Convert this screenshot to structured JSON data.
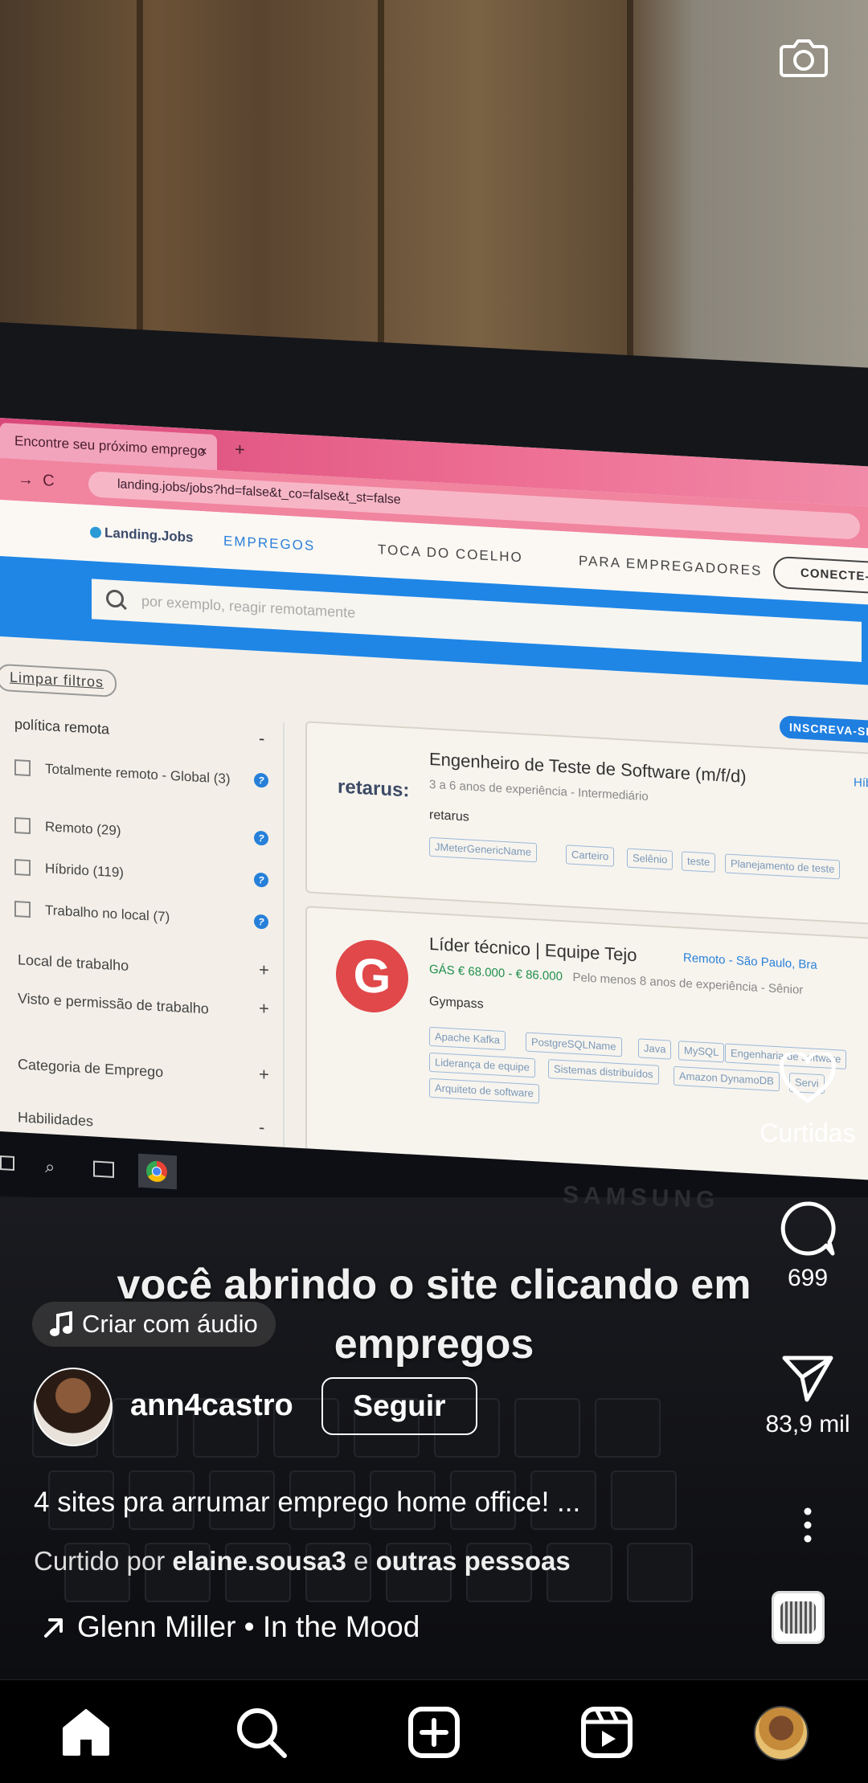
{
  "video": {
    "browser": {
      "tab_title": "Encontre seu próximo emprego",
      "tab_close": "×",
      "new_tab": "+",
      "url": "landing.jobs/jobs?hd=false&t_co=false&t_st=false",
      "nav_back": "→",
      "nav_reload": "C"
    },
    "site": {
      "logo": "Landing.Jobs",
      "nav": [
        "EMPREGOS",
        "TOCA DO COELHO",
        "PARA EMPREGADORES"
      ],
      "cta": "CONECTE-S",
      "search_placeholder": "por exemplo, reagir remotamente",
      "clear_filters": "Limpar filtros",
      "subscribe": "INSCREVA-SE",
      "filter_title": "política remota",
      "filter_minus": "-",
      "filters": [
        {
          "label": "Totalmente remoto - Global (3)"
        },
        {
          "label": "Remoto (29)"
        },
        {
          "label": "Híbrido (119)"
        },
        {
          "label": "Trabalho no local (7)"
        }
      ],
      "help": "?",
      "sections": [
        {
          "label": "Local de trabalho",
          "sign": "+"
        },
        {
          "label": "Visto e permissão de trabalho",
          "sign": "+"
        },
        {
          "label": "Categoria de Emprego",
          "sign": "+"
        },
        {
          "label": "Habilidades",
          "sign": "-"
        }
      ],
      "jobs": [
        {
          "logo": "retarus:",
          "title": "Engenheiro de Teste de Software (m/f/d)",
          "location": "Híbrid",
          "meta": "3 a 6 anos de experiência - Intermediário",
          "company": "retarus",
          "tags": [
            "JMeterGenericName",
            "Carteiro",
            "Selênio",
            "teste",
            "Planejamento de teste"
          ]
        },
        {
          "logo": "G",
          "title": "Líder técnico | Equipe Tejo",
          "location": "Remoto - São Paulo, Bra",
          "salary": "GÁS € 68.000 - € 86.000",
          "meta": "Pelo menos 8 anos de experiência - Sênior",
          "company": "Gympass",
          "tags": [
            "Apache Kafka",
            "PostgreSQLName",
            "Java",
            "MySQL",
            "Engenharia de software",
            "Liderança de equipe",
            "Sistemas distribuídos",
            "Amazon DynamoDB",
            "Servi",
            "Arquiteto de software"
          ]
        }
      ]
    },
    "laptop_brand": "SAMSUNG",
    "caption": "você abrindo o site clicando em empregos"
  },
  "reel": {
    "audio_pill": "Criar com áudio",
    "username": "ann4castro",
    "follow": "Seguir",
    "description": "4 sites pra arrumar emprego home office! ...",
    "liked_prefix": "Curtido por",
    "liked_user": "elaine.sousa3",
    "liked_join": "e",
    "liked_others": "outras pessoas",
    "music": "Glenn Miller • In the Mood",
    "likes_label": "Curtidas",
    "comments_count": "699",
    "shares_count": "83,9 mil"
  },
  "icons": {
    "camera": "camera-icon",
    "like": "heart-icon",
    "comment": "comment-icon",
    "share": "send-icon",
    "more": "more-icon",
    "music_note": "music-note-icon",
    "music_arrow": "arrow-icon",
    "home": "home-icon",
    "search": "search-icon",
    "create": "create-icon",
    "reels": "reels-icon",
    "profile": "profile-avatar"
  }
}
